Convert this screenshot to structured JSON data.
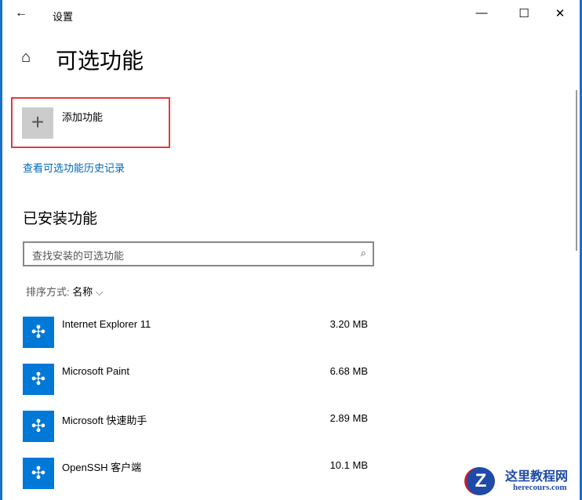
{
  "window": {
    "title": "设置",
    "back": "←",
    "minimize": "—",
    "maximize": "☐",
    "close": "✕"
  },
  "page": {
    "title": "可选功能",
    "home_icon": "⌂"
  },
  "add_feature": {
    "label": "添加功能",
    "icon": "+"
  },
  "history_link": "查看可选功能历史记录",
  "installed": {
    "heading": "已安装功能",
    "search_placeholder": "查找安装的可选功能",
    "sort_label": "排序方式:",
    "sort_value": "名称",
    "sort_chevron": "⌵"
  },
  "features": [
    {
      "name": "Internet Explorer 11",
      "size": "3.20 MB"
    },
    {
      "name": "Microsoft Paint",
      "size": "6.68 MB"
    },
    {
      "name": "Microsoft 快速助手",
      "size": "2.89 MB"
    },
    {
      "name": "OpenSSH 客户端",
      "size": "10.1 MB"
    }
  ],
  "watermark": {
    "name": "这里教程网",
    "url": "herecours.com",
    "logo": "Z"
  }
}
